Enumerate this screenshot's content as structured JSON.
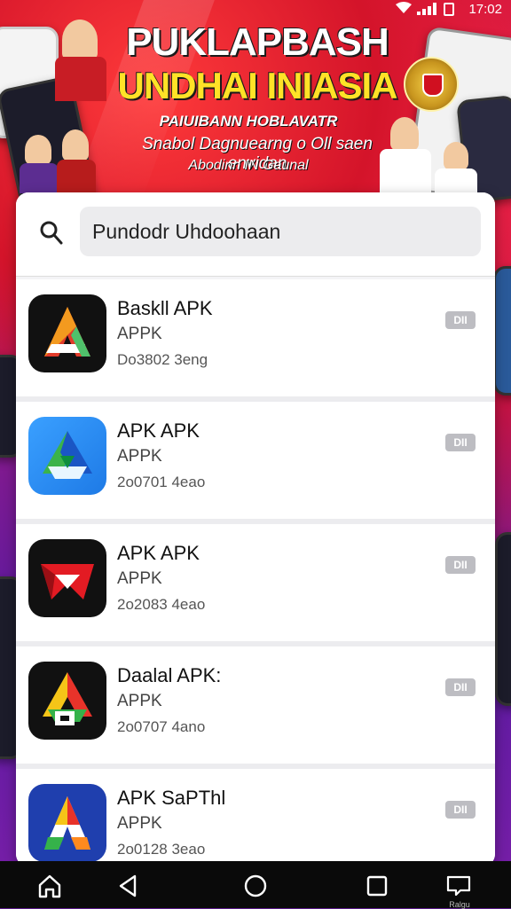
{
  "status": {
    "time": "17:02"
  },
  "banner": {
    "headline": "PUKLAPBASH",
    "headline2": "UNDHAI INIASIA",
    "sub1": "PAIUIBANN HOBLAVATR",
    "sub2": "Snabol Dagnuearng o Oll saen envidan",
    "sub3": "Abodinn IN Gaunal"
  },
  "search": {
    "value": "Pundodr Uhdoohaan"
  },
  "apps": [
    {
      "name": "Baskll APK",
      "dev": "APPK",
      "meta": "Do3802 3eng",
      "badge": "DII",
      "icon": "red-orange-a-icon"
    },
    {
      "name": "APK APK",
      "dev": "APPK",
      "meta": "2o0701 4eao",
      "badge": "DII",
      "icon": "blue-green-triangle-icon"
    },
    {
      "name": "APK APK",
      "dev": "APPK",
      "meta": "2o2083 4eao",
      "badge": "DII",
      "icon": "red-arrow-icon"
    },
    {
      "name": "Daalal APK:",
      "dev": "APPK",
      "meta": "2o0707 4ano",
      "badge": "DII",
      "icon": "tricolor-triangle-icon"
    },
    {
      "name": "APK SaPThl",
      "dev": "APPK",
      "meta": "2o0128 3eao",
      "badge": "DII",
      "icon": "colorful-a-icon"
    }
  ],
  "navbar": {
    "label": "Ralgu"
  }
}
